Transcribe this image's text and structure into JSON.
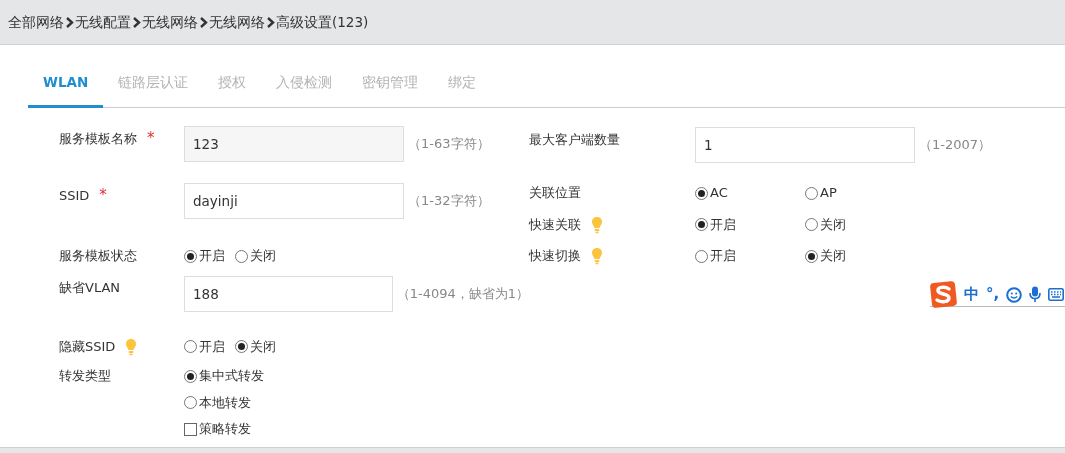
{
  "breadcrumb": [
    "全部网络",
    "无线配置",
    "无线网络",
    "无线网络",
    "高级设置(123)"
  ],
  "tabs": [
    {
      "label": "WLAN",
      "selected": true
    },
    {
      "label": "链路层认证",
      "selected": false
    },
    {
      "label": "授权",
      "selected": false
    },
    {
      "label": "入侵检测",
      "selected": false
    },
    {
      "label": "密钥管理",
      "selected": false
    },
    {
      "label": "绑定",
      "selected": false
    }
  ],
  "left_fields": [
    {
      "kind": "input",
      "label": "服务模板名称",
      "required_mark": "*",
      "value": "123",
      "disabled": true,
      "hint": "（1-63字符）"
    },
    {
      "kind": "input",
      "label": "SSID",
      "required_mark": "*",
      "value": "dayinji",
      "hint": "（1-32字符）"
    },
    {
      "kind": "radio",
      "label": "服务模板状态",
      "options": [
        {
          "kind": "radio",
          "label": "开启",
          "selected": true
        },
        {
          "kind": "radio",
          "label": "关闭",
          "selected": false
        }
      ]
    },
    {
      "kind": "input",
      "label": "缺省VLAN",
      "value": "188",
      "hint": "（1-4094，缺省为1）"
    },
    {
      "kind": "radio",
      "label": "隐藏SSID",
      "tip": true,
      "options": [
        {
          "kind": "radio",
          "label": "开启",
          "selected": false
        },
        {
          "kind": "radio",
          "label": "关闭",
          "selected": true
        }
      ]
    },
    {
      "kind": "stack",
      "label": "转发类型",
      "options": [
        {
          "kind": "radio",
          "label": "集中式转发",
          "selected": true
        },
        {
          "kind": "radio",
          "label": "本地转发",
          "selected": false
        },
        {
          "kind": "checkbox",
          "label": "策略转发",
          "checked": false
        }
      ]
    }
  ],
  "right_fields": [
    {
      "kind": "input",
      "label": "最大客户端数量",
      "value": "1",
      "hint": "（1-2007）"
    },
    {
      "kind": "radio",
      "label": "关联位置",
      "options": [
        {
          "kind": "radio",
          "label": "AC",
          "selected": true
        },
        {
          "kind": "radio",
          "label": "AP",
          "selected": false
        }
      ]
    },
    {
      "kind": "radio",
      "label": "快速关联",
      "tip": true,
      "options": [
        {
          "kind": "radio",
          "label": "开启",
          "selected": true
        },
        {
          "kind": "radio",
          "label": "关闭",
          "selected": false
        }
      ]
    },
    {
      "kind": "radio",
      "label": "快速切换",
      "tip": true,
      "options": [
        {
          "kind": "radio",
          "label": "开启",
          "selected": false
        },
        {
          "kind": "radio",
          "label": "关闭",
          "selected": true
        }
      ]
    }
  ],
  "ime_toolbar": {
    "mode": "中",
    "punctuation": "°,"
  }
}
